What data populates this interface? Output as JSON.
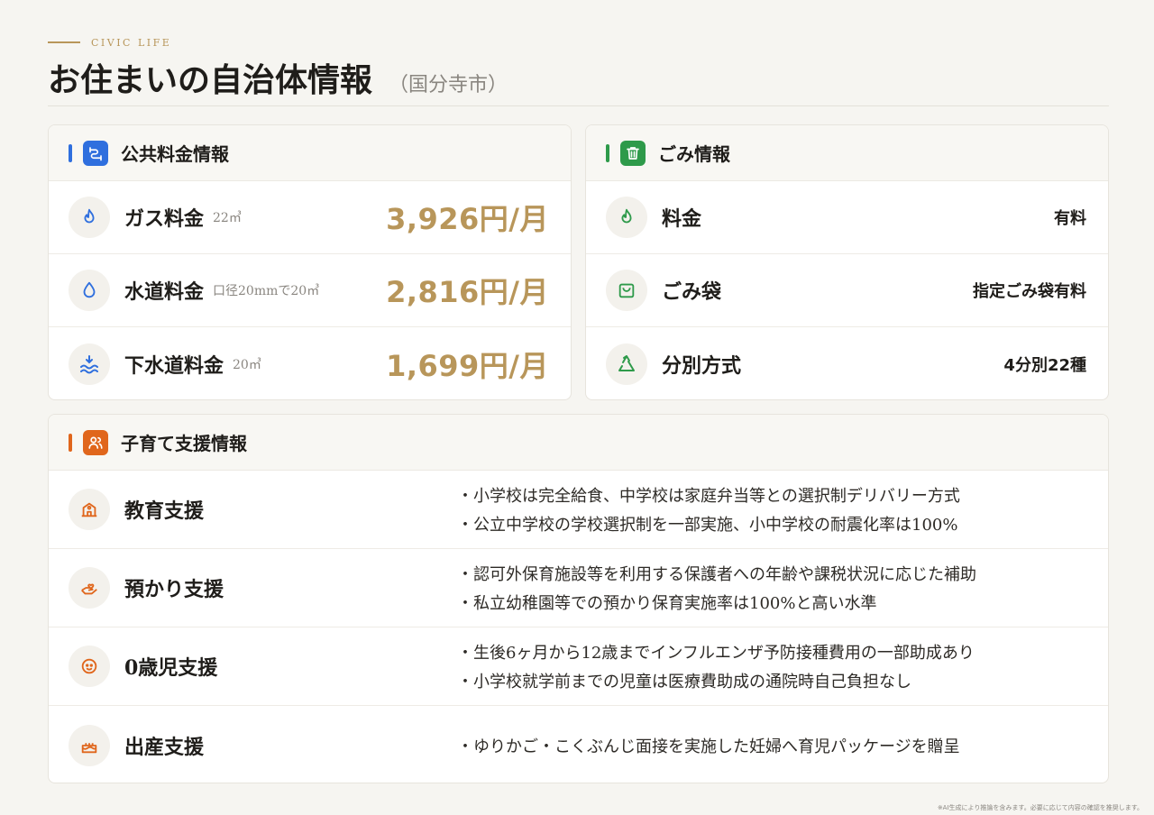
{
  "header": {
    "eyebrow": "CIVIC LIFE",
    "title": "お住まいの自治体情報",
    "subtitle": "（国分寺市）"
  },
  "colors": {
    "gold": "#b8965a",
    "blue": "#2f6fde",
    "green": "#2e9a4a",
    "orange": "#e0661c"
  },
  "utilities": {
    "title": "公共料金情報",
    "icon": "pipe-icon",
    "items": [
      {
        "icon": "flame-icon",
        "label": "ガス料金",
        "note": "22㎥",
        "value": "3,926円/月"
      },
      {
        "icon": "water-drop-icon",
        "label": "水道料金",
        "note": "口径20mmで20㎥",
        "value": "2,816円/月"
      },
      {
        "icon": "sewage-waves-icon",
        "label": "下水道料金",
        "note": "20㎥",
        "value": "1,699円/月"
      }
    ]
  },
  "garbage": {
    "title": "ごみ情報",
    "icon": "trash-icon",
    "items": [
      {
        "icon": "flame-icon",
        "label": "料金",
        "value": "有料"
      },
      {
        "icon": "shopping-bag-icon",
        "label": "ごみ袋",
        "value": "指定ごみ袋有料"
      },
      {
        "icon": "recycle-icon",
        "label": "分別方式",
        "value": "4分別22種"
      }
    ]
  },
  "childcare": {
    "title": "子育て支援情報",
    "icon": "users-icon",
    "items": [
      {
        "icon": "school-icon",
        "label": "教育支援",
        "bullets": [
          "・小学校は完全給食、中学校は家庭弁当等との選択制デリバリー方式",
          "・公立中学校の学校選択制を一部実施、小中学校の耐震化率は100%"
        ]
      },
      {
        "icon": "hand-heart-icon",
        "label": "預かり支援",
        "bullets": [
          "・認可外保育施設等を利用する保護者への年齢や課税状況に応じた補助",
          "・私立幼稚園等での預かり保育実施率は100%と高い水準"
        ]
      },
      {
        "icon": "baby-icon",
        "label": "0歳児支援",
        "bullets": [
          "・生後6ヶ月から12歳までインフルエンザ予防接種費用の一部助成あり",
          "・小学校就学前までの児童は医療費助成の通院時自己負担なし"
        ]
      },
      {
        "icon": "cake-icon",
        "label": "出産支援",
        "bullets": [
          "・ゆりかご・こくぶんじ面接を実施した妊婦へ育児パッケージを贈呈"
        ]
      }
    ]
  },
  "footnote": "※AI生成により推論を含みます。必要に応じて内容の確認を推奨します。"
}
